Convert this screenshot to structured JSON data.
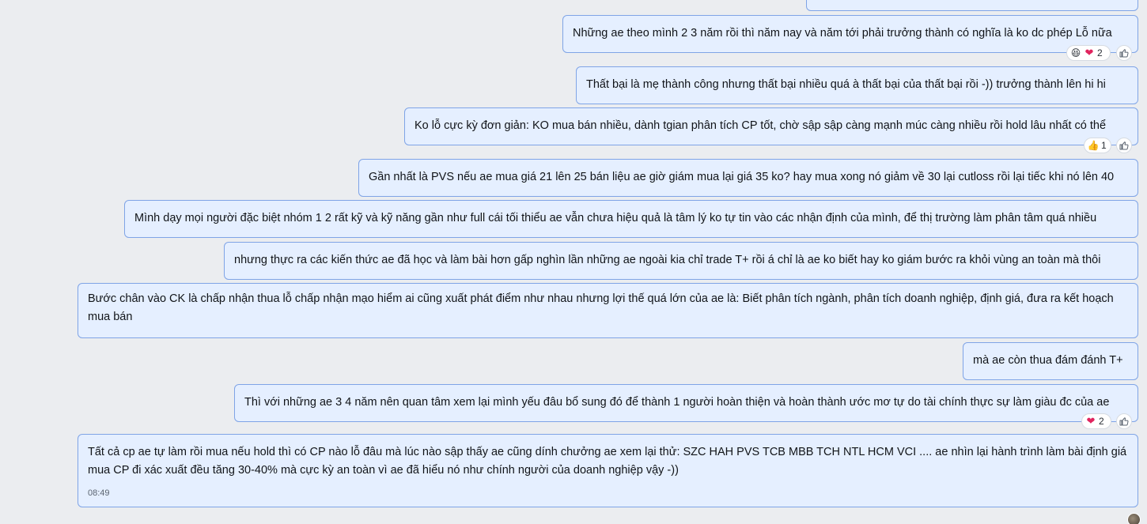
{
  "messages": [
    {
      "text": ""
    },
    {
      "text": "Những ae theo mình 2 3 năm rồi thì năm nay và năm tới phải trưởng thành có nghĩa là ko dc phép Lỗ nữa",
      "reactions": {
        "emojis": [
          "laughing-emoji",
          "heart-emoji"
        ],
        "count": "2"
      }
    },
    {
      "text": "Thất bại là mẹ thành công nhưng thất bại nhiều quá à thất bại của thất bại rồi -)) trưởng thành lên hi hi"
    },
    {
      "text": "Ko lỗ cực kỳ đơn giản: KO mua bán nhiều, dành tgian phân tích CP tốt, chờ sập sập càng mạnh múc càng nhiều rồi hold lâu nhất có thể",
      "reactions": {
        "emojis": [
          "thumbs-up-emoji"
        ],
        "count": "1"
      }
    },
    {
      "text": "Gần nhất là PVS nếu ae mua giá 21 lên 25 bán liệu ae giờ giám mua lại giá 35 ko? hay mua xong nó giảm về 30 lại cutloss rồi lại tiếc khi nó lên 40"
    },
    {
      "text": "Mình dạy mọi người đặc biệt nhóm 1 2 rất kỹ và kỹ năng gần như full cái tối thiểu ae vẫn chưa hiệu quả là tâm lý ko tự tin vào các nhận định của mình, để thị trường làm phân tâm quá nhiều"
    },
    {
      "text": "nhưng thực ra các kiến thức ae đã học và làm bài hơn gấp nghìn lần những ae ngoài kia chỉ trade T+ rồi á chỉ là ae ko biết hay ko giám bước ra khỏi vùng an toàn mà thôi"
    },
    {
      "text": "Bước chân vào CK là chấp nhận thua lỗ chấp nhận mạo hiểm ai cũng xuất phát điểm như nhau nhưng lợi thế quá lớn của ae là: Biết phân tích ngành, phân tích doanh nghiệp, định giá, đưa ra kết hoạch mua bán"
    },
    {
      "text": "mà ae còn thua đám đánh T+"
    },
    {
      "text": "Thì với những ae 3 4 năm nên quan tâm xem lại mình yếu đâu bổ sung đó để thành 1 người hoàn thiện và hoàn thành ước mơ tự do tài chính thực sự làm giàu đc của ae",
      "reactions": {
        "emojis": [
          "heart-emoji"
        ],
        "count": "2"
      }
    },
    {
      "text": "Tất cả cp ae tự làm rồi mua nếu hold thì có CP nào lỗ đâu mà lúc nào sập thấy ae cũng dính chưởng ae xem lại thử: SZC HAH PVS TCB MBB TCH NTL HCM VCI .... ae nhìn lại hành trình làm bài định giá mua CP đi xác xuất đều tăng 30-40% mà cực kỳ an toàn vì ae đã hiểu nó như chính người của doanh nghiệp vậy -))",
      "time": "08:49"
    }
  ],
  "colors": {
    "background": "#ebedf0",
    "bubble": "#e5efff",
    "bubble_border": "#7fa4e6"
  }
}
